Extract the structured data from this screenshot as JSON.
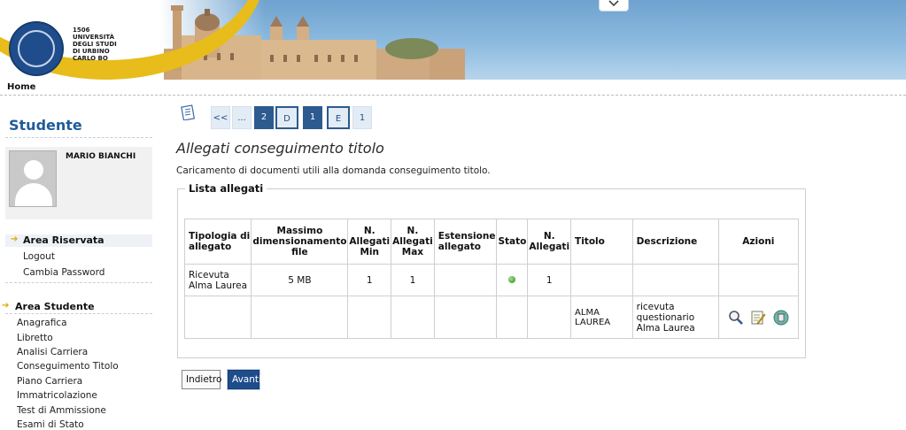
{
  "header": {
    "logo_lines": [
      "1506",
      "UNIVERSITÀ",
      "DEGLI STUDI",
      "DI URBINO",
      "CARLO BO"
    ],
    "toggle_icon": "chevron-down-icon"
  },
  "breadcrumb": {
    "home": "Home"
  },
  "sidebar": {
    "title": "Studente",
    "user_name": "MARIO BIANCHI",
    "area_riservata": {
      "label": "Area Riservata",
      "items": [
        "Logout",
        "Cambia Password"
      ]
    },
    "area_studente": {
      "label": "Area Studente",
      "items": [
        "Anagrafica",
        "Libretto",
        "Analisi Carriera",
        "Conseguimento Titolo",
        "Piano Carriera",
        "Immatricolazione",
        "Test di Ammissione",
        "Esami di Stato"
      ]
    }
  },
  "steps": [
    "<<",
    "...",
    "2",
    "D",
    "1",
    "E",
    "1"
  ],
  "page": {
    "title": "Allegati conseguimento titolo",
    "description": "Caricamento di documenti utili alla domanda conseguimento titolo.",
    "fieldset_legend": "Lista allegati"
  },
  "table": {
    "headers": [
      "Tipologia di allegato",
      "Massimo dimensionamento file",
      "N. Allegati Min",
      "N. Allegati Max",
      "Estensione allegato",
      "Stato",
      "N. Allegati",
      "Titolo",
      "Descrizione",
      "Azioni"
    ],
    "row1": {
      "tipologia": "Ricevuta Alma Laurea",
      "massimo": "5 MB",
      "min": "1",
      "max": "1",
      "estensione": "",
      "stato": "green",
      "n_allegati": "1"
    },
    "row2": {
      "titolo": "ALMA LAUREA",
      "descrizione": "ricevuta questionario Alma Laurea",
      "actions": [
        "magnifier-icon",
        "edit-icon",
        "delete-icon"
      ]
    }
  },
  "buttons": {
    "back": "Indietro",
    "next": "Avanti"
  },
  "colors": {
    "brand_blue": "#1f4d8c",
    "accent_yellow": "#e8bc1a",
    "status_green": "#2e8a1c"
  }
}
